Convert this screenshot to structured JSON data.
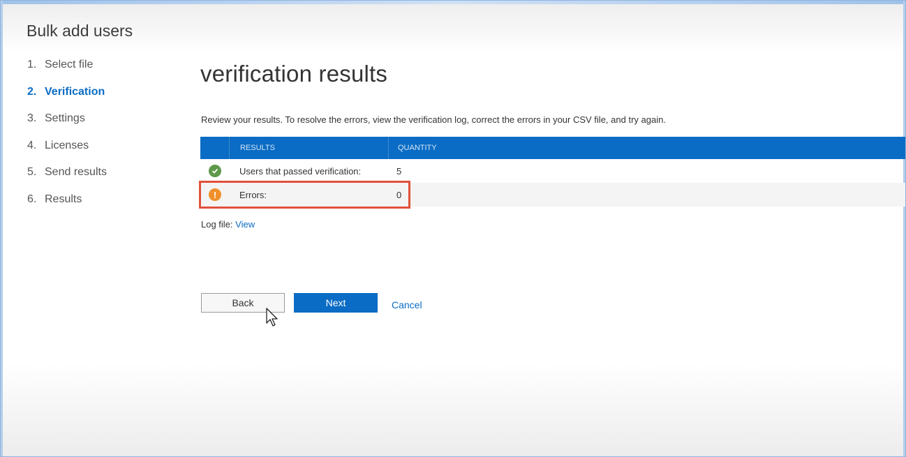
{
  "app": {
    "title": "Bulk add users"
  },
  "steps": [
    {
      "num": "1.",
      "label": "Select file"
    },
    {
      "num": "2.",
      "label": "Verification"
    },
    {
      "num": "3.",
      "label": "Settings"
    },
    {
      "num": "4.",
      "label": "Licenses"
    },
    {
      "num": "5.",
      "label": "Send results"
    },
    {
      "num": "6.",
      "label": "Results"
    }
  ],
  "active_step": 2,
  "main": {
    "title": "verification results",
    "instructions": "Review your results. To resolve the errors, view the verification log, correct the errors in your CSV file, and try again.",
    "table": {
      "headers": {
        "results": "RESULTS",
        "quantity": "QUANTITY"
      },
      "rows": [
        {
          "icon": "check-circle-icon",
          "label": "Users that passed verification:",
          "quantity": "5"
        },
        {
          "icon": "warning-circle-icon",
          "label": "Errors:",
          "quantity": "0"
        }
      ]
    },
    "log_file": {
      "label": "Log file:",
      "link": "View"
    }
  },
  "actions": {
    "back": "Back",
    "next": "Next",
    "cancel": "Cancel"
  },
  "colors": {
    "accent": "#0a6cc4",
    "success": "#5f9a4a",
    "warning": "#f0902a",
    "highlight": "#e0513b"
  }
}
